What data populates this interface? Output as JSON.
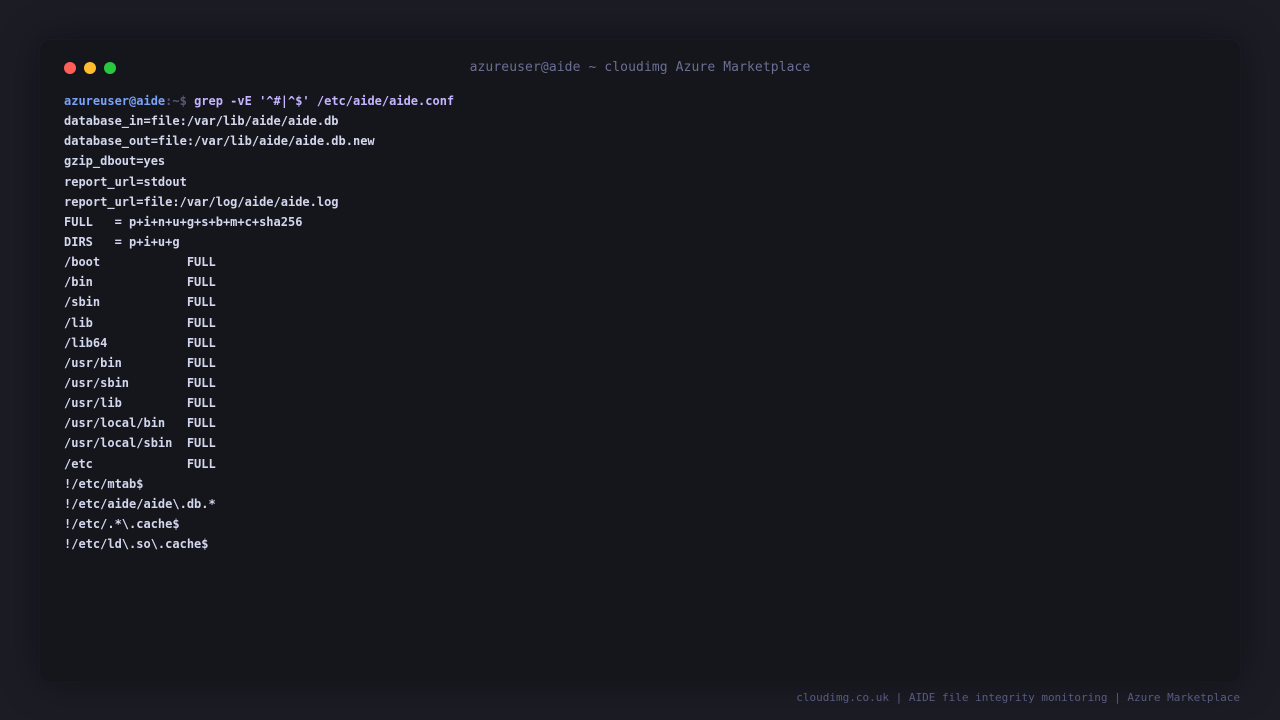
{
  "window": {
    "title": "azureuser@aide ~ cloudimg Azure Marketplace"
  },
  "prompt": {
    "user_host": "azureuser@aide",
    "path": ":~$ ",
    "command": "grep -vE '^#|^$' /etc/aide/aide.conf"
  },
  "output_lines": [
    "database_in=file:/var/lib/aide/aide.db",
    "database_out=file:/var/lib/aide/aide.db.new",
    "gzip_dbout=yes",
    "report_url=stdout",
    "report_url=file:/var/log/aide/aide.log",
    "FULL   = p+i+n+u+g+s+b+m+c+sha256",
    "DIRS   = p+i+u+g",
    "/boot            FULL",
    "/bin             FULL",
    "/sbin            FULL",
    "/lib             FULL",
    "/lib64           FULL",
    "/usr/bin         FULL",
    "/usr/sbin        FULL",
    "/usr/lib         FULL",
    "/usr/local/bin   FULL",
    "/usr/local/sbin  FULL",
    "/etc             FULL",
    "!/etc/mtab$",
    "!/etc/aide/aide\\.db.*",
    "!/etc/.*\\.cache$",
    "!/etc/ld\\.so\\.cache$"
  ],
  "footer": {
    "text": "cloudimg.co.uk | AIDE file integrity monitoring | Azure Marketplace"
  },
  "colors": {
    "background": "#1b1c24",
    "terminal": "#15161c",
    "prompt_user": "#7aa2f7",
    "command": "#c5b4ff",
    "output": "#d3d7ee",
    "close": "#ff5f57",
    "minimize": "#febc2e",
    "maximize": "#28c840"
  }
}
